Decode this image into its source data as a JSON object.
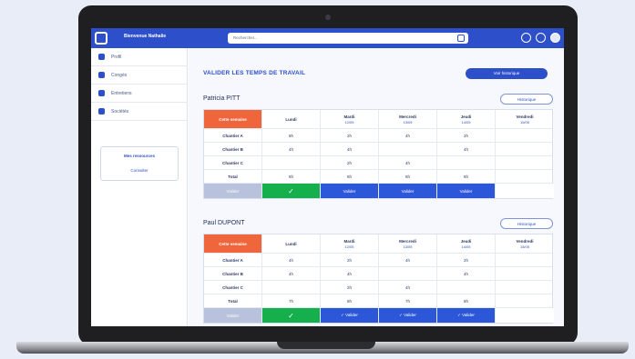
{
  "app": {
    "brand_name": "Bienvenue Nathalie"
  },
  "search": {
    "placeholder": "Rechercher..."
  },
  "sidebar": {
    "items": [
      {
        "label": "Profil"
      },
      {
        "label": "Congés"
      },
      {
        "label": "Entretiens"
      },
      {
        "label": "Sociétés"
      }
    ],
    "box_title": "Mes ressources",
    "box_link": "Consulter"
  },
  "main": {
    "title": "VALIDER LES TEMPS DE TRAVAIL",
    "history_button": "Voir historique"
  },
  "employees": [
    {
      "name": "Patricia PITT",
      "button": "Historique",
      "header": [
        "Cette semaine",
        "Lundi",
        "Mardi",
        "Mercredi",
        "Jeudi",
        "Vendredi"
      ],
      "dates": [
        "",
        "",
        "12/05",
        "13/05",
        "14/05",
        "15/05"
      ],
      "rows": [
        {
          "label": "Chantier A",
          "cells": [
            "8h",
            "2h",
            "4h",
            "2h",
            ""
          ]
        },
        {
          "label": "Chantier B",
          "cells": [
            "4h",
            "4h",
            "",
            "4h",
            ""
          ]
        },
        {
          "label": "Chantier C",
          "cells": [
            "",
            "2h",
            "4h",
            "",
            ""
          ]
        },
        {
          "label": "Total",
          "cells": [
            "8h",
            "8h",
            "8h",
            "8h",
            ""
          ]
        }
      ],
      "actions": [
        "Valider",
        "✓",
        "Valider",
        "Valider",
        "Valider",
        ""
      ]
    },
    {
      "name": "Paul DUPONT",
      "button": "Historique",
      "header": [
        "Cette semaine",
        "Lundi",
        "Mardi",
        "Mercredi",
        "Jeudi",
        "Vendredi"
      ],
      "dates": [
        "",
        "",
        "12/05",
        "13/05",
        "14/05",
        "15/05"
      ],
      "rows": [
        {
          "label": "Chantier A",
          "cells": [
            "4h",
            "2h",
            "4h",
            "2h",
            ""
          ]
        },
        {
          "label": "Chantier B",
          "cells": [
            "4h",
            "4h",
            "",
            "4h",
            ""
          ]
        },
        {
          "label": "Chantier C",
          "cells": [
            "",
            "2h",
            "4h",
            "",
            ""
          ]
        },
        {
          "label": "Total",
          "cells": [
            "7h",
            "8h",
            "7h",
            "8h",
            ""
          ]
        }
      ],
      "actions": [
        "Valider",
        "✓",
        "✓ Valider",
        "✓ Valider",
        "✓ Valider",
        ""
      ]
    }
  ],
  "colors": {
    "primary": "#2d4fc9",
    "accent": "#f0663c",
    "success": "#15b04b"
  }
}
